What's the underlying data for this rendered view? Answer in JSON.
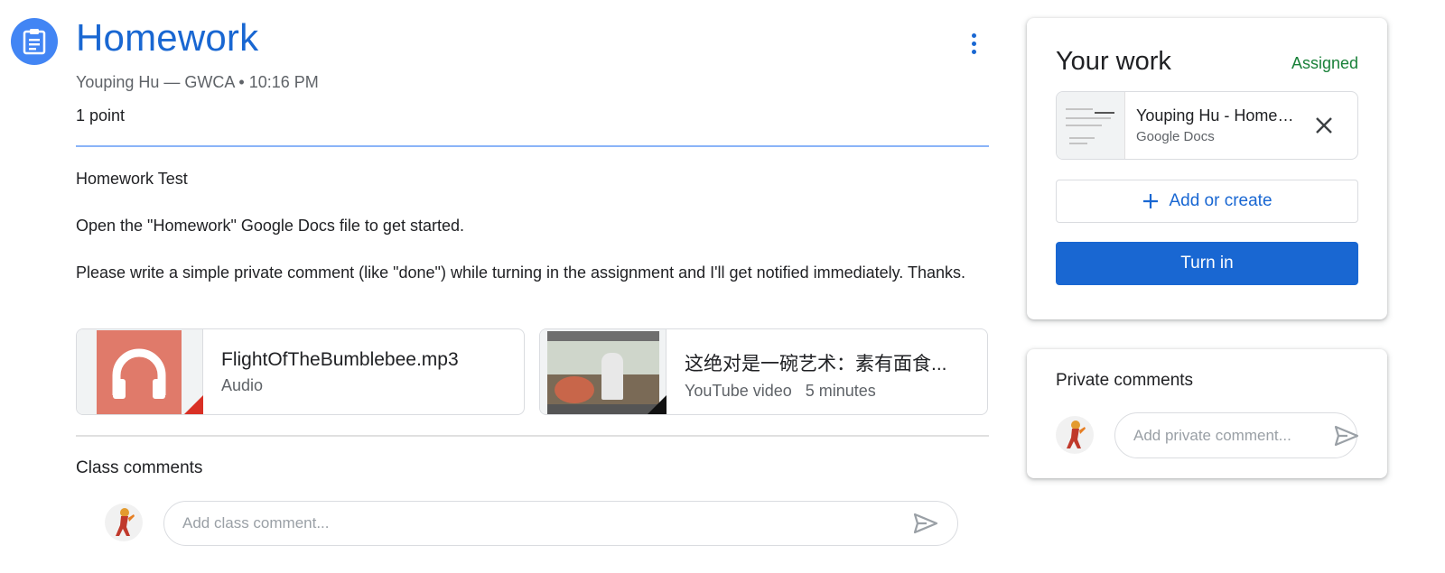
{
  "assignment": {
    "title": "Homework",
    "meta": "Youping Hu — GWCA • 10:16 PM",
    "points": "1 point",
    "description": [
      "Homework Test",
      "Open the \"Homework\" Google Docs file to get started.",
      "Please write a simple private comment (like \"done\") while turning in the assignment and I'll get notified immediately. Thanks."
    ],
    "attachments": [
      {
        "name": "FlightOfTheBumblebee.mp3",
        "type": "Audio",
        "icon": "headphones-icon"
      },
      {
        "name": "这绝对是一碗艺术：素有面食...",
        "type": "YouTube video   5 minutes",
        "icon": "video-thumbnail"
      }
    ]
  },
  "class_comments": {
    "title": "Class comments",
    "placeholder": "Add class comment..."
  },
  "your_work": {
    "title": "Your work",
    "status": "Assigned",
    "status_color": "#188038",
    "file": {
      "name": "Youping Hu - Homework",
      "type": "Google Docs"
    },
    "add_label": "Add or create",
    "turn_in_label": "Turn in"
  },
  "private_comments": {
    "title": "Private comments",
    "placeholder": "Add private comment..."
  },
  "colors": {
    "accent": "#1967d2",
    "icon_bg": "#4285f4"
  }
}
